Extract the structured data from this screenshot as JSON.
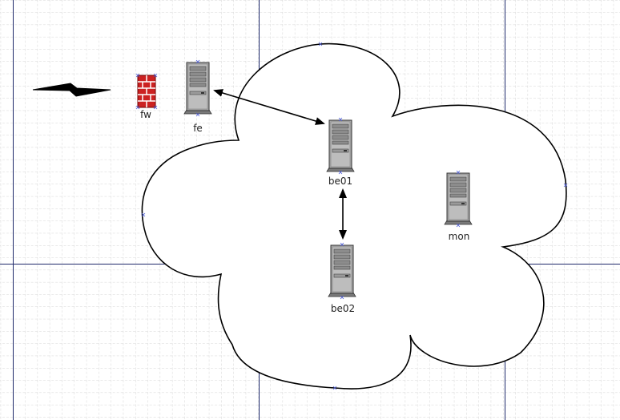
{
  "diagram": {
    "nodes": [
      {
        "id": "fw",
        "label": "fw",
        "icon": "firewall-icon"
      },
      {
        "id": "fe",
        "label": "fe",
        "icon": "server-icon"
      },
      {
        "id": "be01",
        "label": "be01",
        "icon": "server-icon"
      },
      {
        "id": "be02",
        "label": "be02",
        "icon": "server-icon"
      },
      {
        "id": "mon",
        "label": "mon",
        "icon": "server-icon"
      }
    ],
    "edges": [
      {
        "from": "fe",
        "to": "be01",
        "style": "double-arrow"
      },
      {
        "from": "be01",
        "to": "be02",
        "style": "double-arrow"
      }
    ],
    "decorations": [
      {
        "type": "cloud",
        "icon": "cloud-shape"
      },
      {
        "type": "link",
        "icon": "lightning-bolt-icon"
      }
    ],
    "colors": {
      "grid_minor": "#d6d6d6",
      "grid_major": "#1f2a6b",
      "server_body": "#a9a9a9",
      "firewall": "#cc2222",
      "outline": "#000000"
    }
  }
}
